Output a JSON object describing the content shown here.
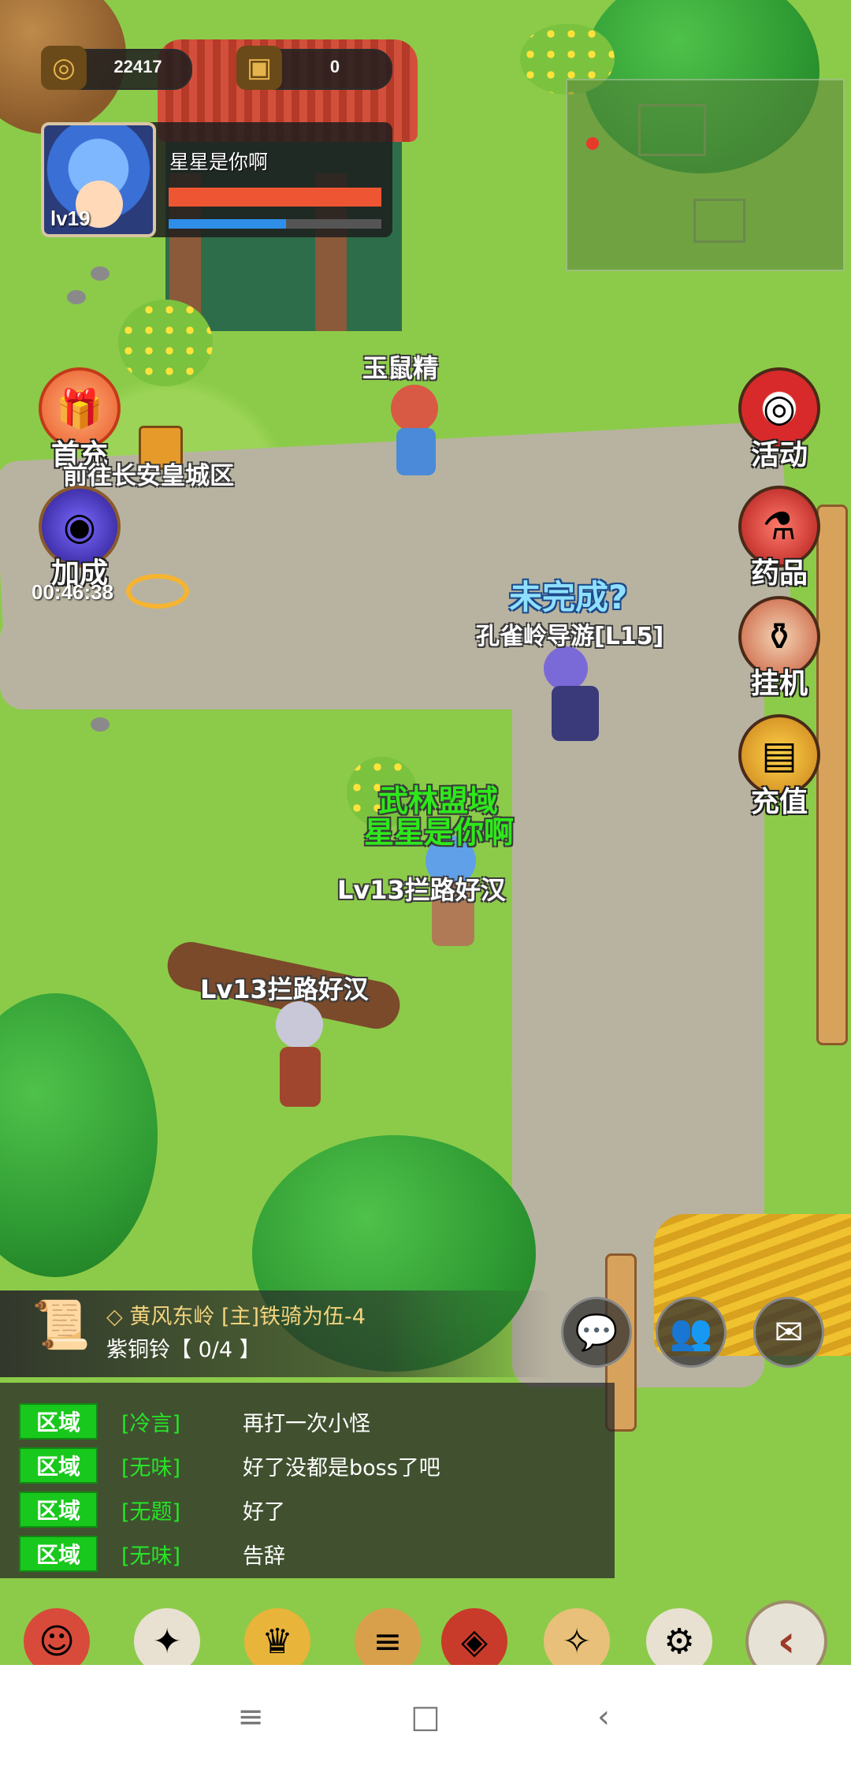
{
  "hud": {
    "gold": {
      "icon": "coin-icon",
      "value": "22417"
    },
    "ingot": {
      "icon": "ingot-icon",
      "value": "0"
    }
  },
  "player": {
    "name": "星星是你啊",
    "level": "lv19",
    "hp_fraction": 1.0,
    "mp_fraction": 0.55
  },
  "left_buttons": {
    "first_recharge": "首充",
    "bonus": "加成",
    "bonus_timer": "00:46:38",
    "portal": "前往长安皇城区"
  },
  "right_buttons": {
    "activity": "活动",
    "potion": "药品",
    "auto": "挂机",
    "recharge": "充值"
  },
  "scene_labels": {
    "npc_jade_rat": "玉鼠精",
    "quest_status": "未完成?",
    "npc_guide": "孔雀岭导游[L15]",
    "player_guild": "武林盟域",
    "player_name": "星星是你啊",
    "enemy1": "Lv13拦路好汉",
    "enemy2": "Lv13拦路好汉"
  },
  "quest": {
    "title": "黄风东岭 [主]铁骑为伍-4",
    "progress": "紫铜铃【 0/4 】"
  },
  "chat": {
    "messages": [
      {
        "channel": "区域",
        "sender": "[冷言]",
        "text": "再打一次小怪"
      },
      {
        "channel": "区域",
        "sender": "[无味]",
        "text": "好了没都是boss了吧"
      },
      {
        "channel": "区域",
        "sender": "[无题]",
        "text": "好了"
      },
      {
        "channel": "区域",
        "sender": "[无味]",
        "text": "告辞"
      }
    ]
  },
  "colors": {
    "hp": "#ee5633",
    "mp": "#2f8fe8",
    "chat_channel": "#19c81c",
    "chat_sender": "#25e626",
    "guild_name": "#2ee81a"
  }
}
